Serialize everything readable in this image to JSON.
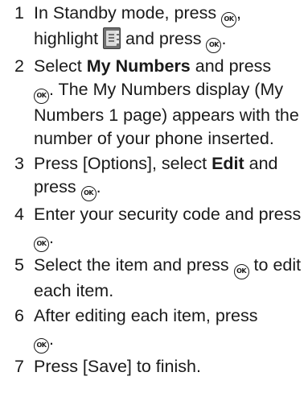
{
  "steps": [
    {
      "number": "1",
      "part1": "In Standby mode, press ",
      "part2": ",",
      "part3": "highlight ",
      "part4": " and press ",
      "part5": "."
    },
    {
      "number": "2",
      "pre": "Select ",
      "bold": "My Numbers",
      "post": " and press",
      "after_icon": ". The My Numbers display (My Numbers 1 page) appears with the number of your phone inserted."
    },
    {
      "number": "3",
      "pre": "Press [Options], select ",
      "bold": "Edit",
      "post": " and press ",
      "end": "."
    },
    {
      "number": "4",
      "pre": "Enter your security code and press ",
      "end": "."
    },
    {
      "number": "5",
      "pre": "Select the item and press ",
      "post": " to edit each item."
    },
    {
      "number": "6",
      "pre": "After editing each item, press ",
      "end": "."
    },
    {
      "number": "7",
      "text": "Press [Save] to finish."
    }
  ],
  "icons": {
    "ok_label": "OK",
    "phonebook": "phonebook-icon"
  }
}
